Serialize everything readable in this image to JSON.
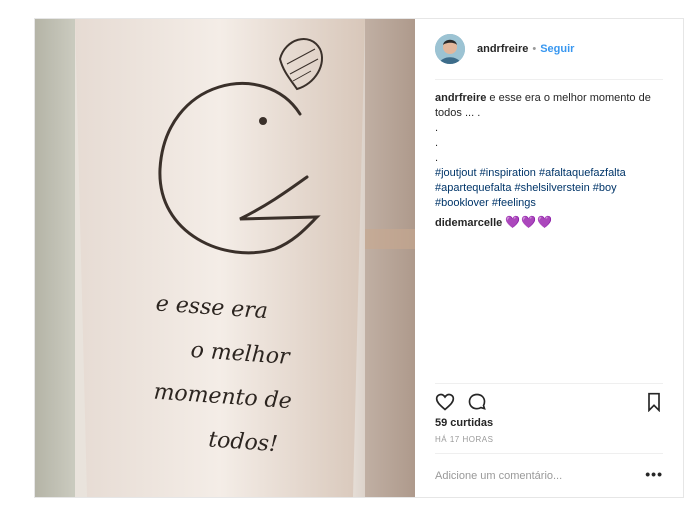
{
  "header": {
    "username": "andrfreire",
    "separator": "•",
    "follow_label": "Seguir"
  },
  "caption": {
    "username": "andrfreire",
    "text": " e esse era o melhor momento de todos ... .",
    "dots": [
      ".",
      ".",
      "."
    ],
    "hashtags": "#joutjout #inspiration #afaltaquefazfalta #apartequefalta #shelsilverstein #boy #booklover #feelings"
  },
  "comment": {
    "username": "didemarcelle",
    "hearts": "💜💜💜"
  },
  "actions": {
    "like_icon": "heart-outline-icon",
    "comment_icon": "speech-bubble-icon",
    "save_icon": "bookmark-icon"
  },
  "likes_label": "59 curtidas",
  "timestamp": "HÁ 17 HORAS",
  "add_comment": {
    "placeholder": "Adicione um comentário...",
    "more_label": "•••"
  },
  "photo": {
    "handwriting_lines": [
      "e esse era",
      "o melhor",
      "momento de",
      "todos!"
    ]
  },
  "colors": {
    "link_blue": "#3897f0",
    "hashtag_blue": "#003569",
    "heart_purple": "#8a5bd6"
  }
}
